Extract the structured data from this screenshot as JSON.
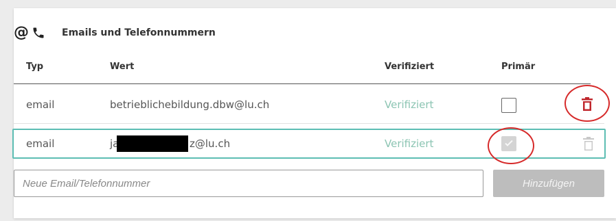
{
  "section": {
    "at_symbol": "@",
    "title": "Emails und Telefonnummern",
    "icons": [
      "at-icon",
      "phone-icon"
    ]
  },
  "table": {
    "columns": [
      "Typ",
      "Wert",
      "Verifiziert",
      "Primär"
    ],
    "rows": [
      {
        "type": "email",
        "value": "betrieblichebildung.dbw@lu.ch",
        "verified": "Verifiziert",
        "primary": false,
        "delete_icon": "trash-icon",
        "delete_color": "#c0272d"
      },
      {
        "type": "email",
        "value_prefix": "ja",
        "value_suffix": "z@lu.ch",
        "verified": "Verifiziert",
        "primary": true,
        "delete_icon": "trash-icon",
        "delete_color": "#c8c8c8",
        "selected": true
      }
    ]
  },
  "new_entry": {
    "placeholder": "Neue Email/Telefonnummer",
    "add_label": "Hinzufügen"
  },
  "colors": {
    "verified_text": "#8bc4b2",
    "selected_border": "#5cbdb3",
    "annotation_circle": "#d62a2a",
    "button_disabled": "#bdbdbd"
  }
}
